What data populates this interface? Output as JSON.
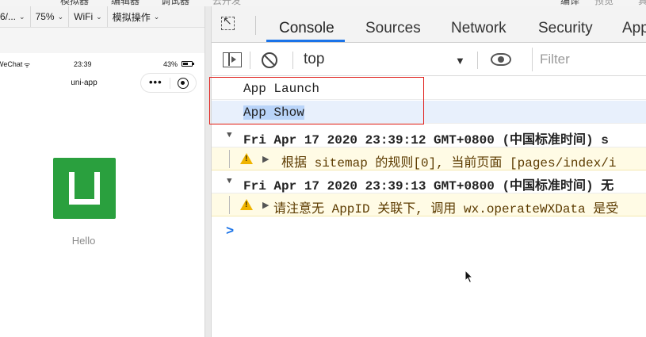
{
  "top_menu": {
    "items": [
      "模拟器",
      "编辑器",
      "调试器",
      "云开发",
      "编译",
      "预览",
      "真"
    ]
  },
  "simulator": {
    "toolbar": {
      "device": "6/...",
      "zoom": "75%",
      "network": "WiFi",
      "operations": "模拟操作"
    },
    "status_bar": {
      "carrier": "WeChat",
      "time": "23:39",
      "battery": "43%"
    },
    "nav_title": "uni-app",
    "hello_text": "Hello",
    "logo_color": "#2aa03e"
  },
  "devtools": {
    "tabs": [
      "Console",
      "Sources",
      "Network",
      "Security",
      "App"
    ],
    "active_tab": "Console",
    "accent": "#1a73e8",
    "context": "top",
    "filter_placeholder": "Filter",
    "console": {
      "lines": [
        {
          "kind": "plain",
          "text": "App Launch"
        },
        {
          "kind": "plain-selected",
          "text": "App Show"
        },
        {
          "kind": "group",
          "text": "Fri Apr 17 2020 23:39:12 GMT+0800 (中国标准时间) s"
        },
        {
          "kind": "warn",
          "text": "根据 sitemap 的规则[0], 当前页面 [pages/index/i"
        },
        {
          "kind": "group",
          "text": "Fri Apr 17 2020 23:39:13 GMT+0800 (中国标准时间) 无"
        },
        {
          "kind": "warn",
          "text": "请注意无 AppID 关联下, 调用 wx.operateWXData 是受"
        }
      ],
      "prompt": ">",
      "warn_color": "#f0b400",
      "highlight_color": "#e0201c"
    }
  }
}
